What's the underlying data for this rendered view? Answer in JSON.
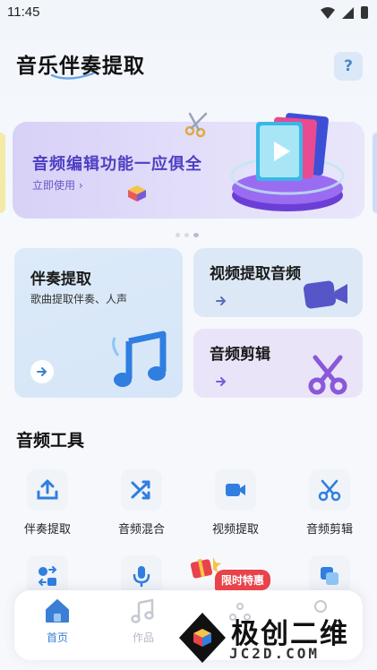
{
  "status_bar": {
    "time": "11:45"
  },
  "header": {
    "title": "音乐伴奏提取",
    "help_label": "?"
  },
  "banner": {
    "title": "音频编辑功能一应俱全",
    "cta": "立即使用",
    "cta_arrow": "›"
  },
  "carousel": {
    "dot_count": 3,
    "active_index": 2
  },
  "features": {
    "accompaniment": {
      "title": "伴奏提取",
      "subtitle": "歌曲提取伴奏、人声"
    },
    "video_extract": {
      "title": "视频提取音频"
    },
    "audio_edit": {
      "title": "音频剪辑"
    }
  },
  "tools": {
    "section_title": "音频工具",
    "items": [
      {
        "label": "伴奏提取",
        "icon": "upload-icon"
      },
      {
        "label": "音频混合",
        "icon": "shuffle-icon"
      },
      {
        "label": "视频提取",
        "icon": "video-camera-icon"
      },
      {
        "label": "音频剪辑",
        "icon": "scissors-icon"
      }
    ],
    "row2_icons": [
      "convert-icon",
      "microphone-icon",
      "merge-icon",
      "copy-icon"
    ]
  },
  "promo": {
    "label": "限时特惠"
  },
  "bottom_nav": {
    "home": "首页",
    "works": "作品"
  },
  "watermark": {
    "text": "极创二维",
    "url": "JC2D.COM"
  },
  "colors": {
    "accent_blue": "#3a7fd5",
    "banner_purple": "#4e3fc2",
    "promo_red": "#e8424a"
  }
}
